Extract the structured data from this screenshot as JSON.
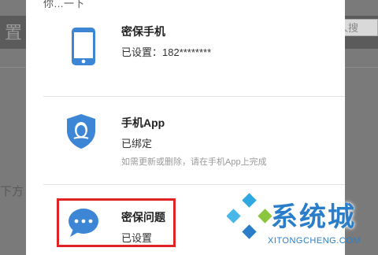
{
  "background": {
    "title_fragment": "置",
    "search_fragment": "人搜",
    "side_text_fragment": "下方"
  },
  "modal": {
    "top_label_fragment": "你…一下",
    "items": [
      {
        "title": "密保手机",
        "status": "已设置：182********",
        "icon": "phone-icon"
      },
      {
        "title": "手机App",
        "status": "已绑定",
        "note": "如需更新或删除，请在手机App上完成",
        "icon": "qq-shield-icon"
      },
      {
        "title": "密保问题",
        "status": "已设置",
        "icon": "chat-bubble-icon"
      }
    ]
  },
  "watermark": {
    "brand": "系统城",
    "domain": "XITONGCHENG.COM"
  },
  "colors": {
    "accent_blue": "#3d86d6",
    "highlight_red": "#e02424",
    "watermark_blue": "#2a7ec9"
  }
}
